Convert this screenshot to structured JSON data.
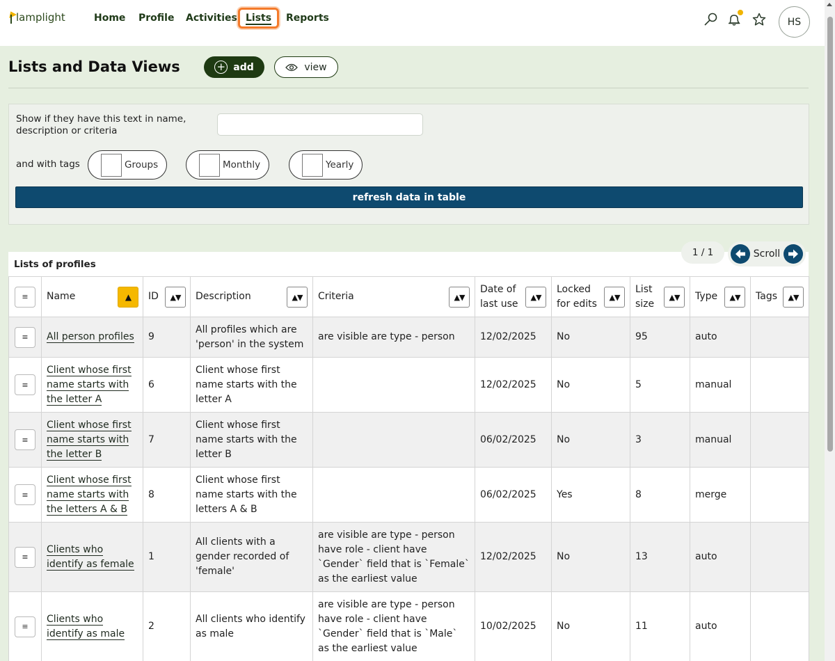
{
  "nav": {
    "logo_text": "lamplight",
    "items": [
      {
        "label": "Home"
      },
      {
        "label": "Profile"
      },
      {
        "label": "Activities"
      },
      {
        "label": "Lists"
      },
      {
        "label": "Reports"
      }
    ],
    "avatar_initials": "HS"
  },
  "header": {
    "title": "Lists and Data Views",
    "add_label": "add",
    "view_label": "view"
  },
  "filter": {
    "text_label": "Show if they have this text in name, description or criteria",
    "text_value": "",
    "tags_label": "and with tags",
    "tags": [
      {
        "label": "Groups"
      },
      {
        "label": "Monthly"
      },
      {
        "label": "Yearly"
      }
    ],
    "refresh_label": "refresh data in table"
  },
  "table": {
    "caption": "Lists of profiles",
    "pager": "1 / 1",
    "scroll_label": "Scroll",
    "menu_glyph": "≡",
    "sort_glyph": "▲▼",
    "sort_active_glyph": "▲",
    "columns": [
      {
        "label": ""
      },
      {
        "label": "Name"
      },
      {
        "label": "ID"
      },
      {
        "label": "Description"
      },
      {
        "label": "Criteria"
      },
      {
        "label": "Date of last use"
      },
      {
        "label": "Locked for edits"
      },
      {
        "label": "List size"
      },
      {
        "label": "Type"
      },
      {
        "label": "Tags"
      }
    ],
    "rows": [
      {
        "name": "All person profiles",
        "id": "9",
        "description": "All profiles which are 'person' in the system",
        "criteria": "are visible are type - person",
        "date": "12/02/2025",
        "locked": "No",
        "size": "95",
        "type": "auto",
        "tags": ""
      },
      {
        "name": "Client whose first name starts with the letter A",
        "id": "6",
        "description": "Client whose first name starts with the letter A",
        "criteria": "",
        "date": "12/02/2025",
        "locked": "No",
        "size": "5",
        "type": "manual",
        "tags": ""
      },
      {
        "name": "Client whose first name starts with the letter B",
        "id": "7",
        "description": "Client whose first name starts with the letter B",
        "criteria": "",
        "date": "06/02/2025",
        "locked": "No",
        "size": "3",
        "type": "manual",
        "tags": ""
      },
      {
        "name": "Client whose first name starts with the letters A & B",
        "id": "8",
        "description": "Client whose first name starts with the letters A & B",
        "criteria": "",
        "date": "06/02/2025",
        "locked": "Yes",
        "size": "8",
        "type": "merge",
        "tags": ""
      },
      {
        "name": "Clients who identify as female",
        "id": "1",
        "description": "All clients with a gender recorded of 'female'",
        "criteria": "are visible are type - person have role - client have `Gender` field that is `Female` as the earliest value",
        "date": "12/02/2025",
        "locked": "No",
        "size": "13",
        "type": "auto",
        "tags": ""
      },
      {
        "name": "Clients who identify as male",
        "id": "2",
        "description": "All clients who identify as male",
        "criteria": "are visible are type - person have role - client have `Gender` field that is `Male` as the earliest value",
        "date": "10/02/2025",
        "locked": "No",
        "size": "11",
        "type": "auto",
        "tags": ""
      }
    ]
  }
}
